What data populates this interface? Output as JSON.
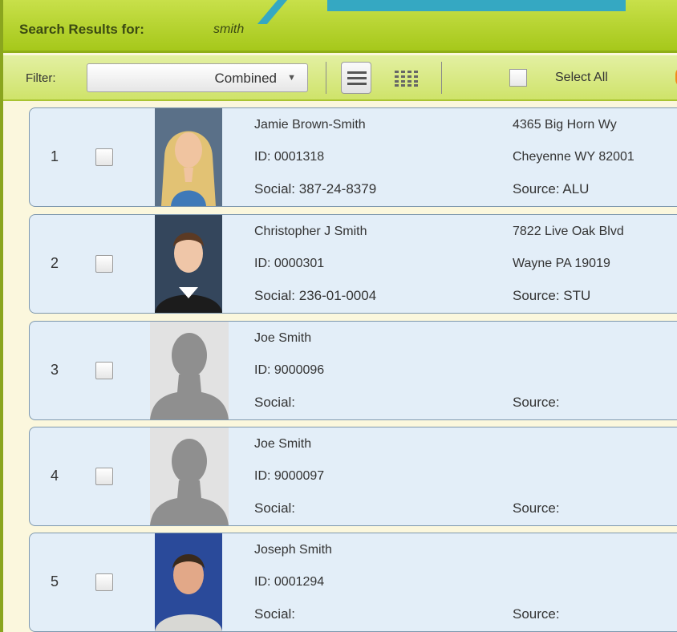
{
  "header": {
    "title": "Search Results for:",
    "search_term": "smith"
  },
  "toolbar": {
    "filter_label": "Filter:",
    "filter_value": "Combined",
    "select_all_label": "Select All",
    "list_view_icon": "list-view-icon",
    "grid_view_icon": "grid-view-icon"
  },
  "results": [
    {
      "index": "1",
      "name": "Jamie Brown-Smith",
      "id_text": "ID: 0001318",
      "social_text": "Social: 387-24-8379",
      "address": "4365 Big Horn Wy",
      "city": "Cheyenne WY 82001",
      "source_text": "Source: ALU",
      "photo": "woman-blonde-portrait"
    },
    {
      "index": "2",
      "name": "Christopher J Smith",
      "id_text": "ID: 0000301",
      "social_text": "Social: 236-01-0004",
      "address": "7822 Live Oak Blvd",
      "city": "Wayne PA 19019",
      "source_text": "Source: STU",
      "photo": "man-dark-hair-portrait"
    },
    {
      "index": "3",
      "name": "Joe Smith",
      "id_text": "ID: 9000096",
      "social_text": "Social:",
      "address": "",
      "city": "",
      "source_text": "Source:",
      "photo": "silhouette-placeholder"
    },
    {
      "index": "4",
      "name": "Joe Smith",
      "id_text": "ID: 9000097",
      "social_text": "Social:",
      "address": "",
      "city": "",
      "source_text": "Source:",
      "photo": "silhouette-placeholder"
    },
    {
      "index": "5",
      "name": "Joseph Smith",
      "id_text": "ID: 0001294",
      "social_text": "Social:",
      "address": "",
      "city": "",
      "source_text": "Source:",
      "photo": "man-blue-background-portrait"
    }
  ],
  "colors": {
    "header_green": "#a6c81a",
    "accent_teal": "#35a8c2",
    "card_bg": "#e3eef8",
    "page_bg": "#fbf7dd"
  }
}
